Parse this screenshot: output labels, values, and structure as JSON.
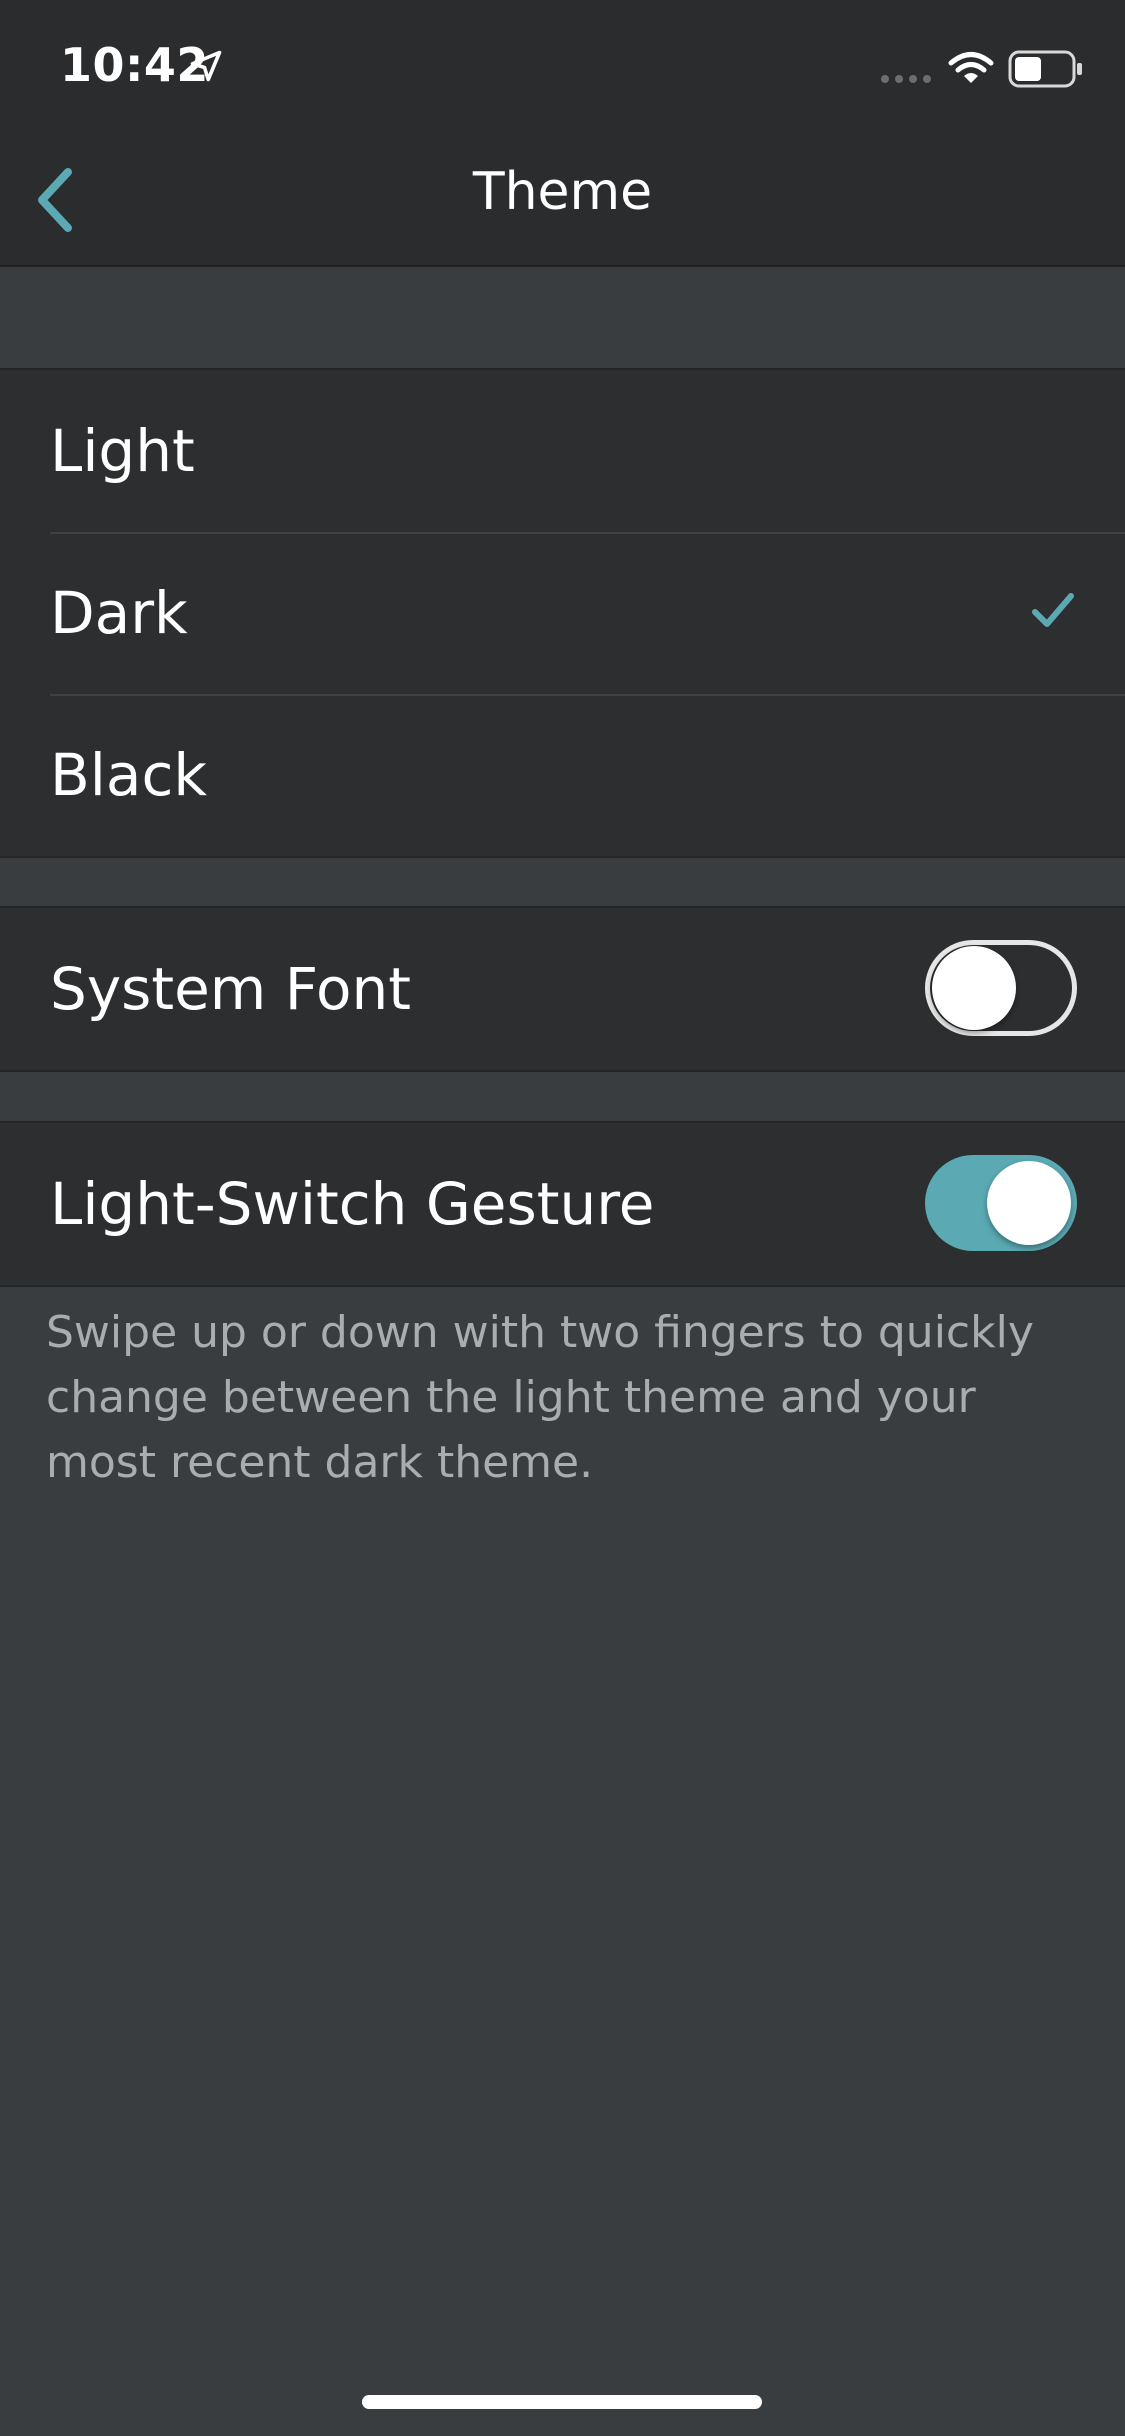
{
  "status_bar": {
    "time": "10:42",
    "icons": [
      "location-arrow-icon",
      "cellular-signal-icon",
      "wifi-icon",
      "battery-icon"
    ]
  },
  "nav": {
    "title": "Theme",
    "back_icon": "chevron-left-icon"
  },
  "themes": {
    "items": [
      {
        "label": "Light",
        "selected": false
      },
      {
        "label": "Dark",
        "selected": true
      },
      {
        "label": "Black",
        "selected": false
      }
    ]
  },
  "system_font": {
    "label": "System Font",
    "enabled": false
  },
  "light_switch": {
    "label": "Light-Switch Gesture",
    "enabled": true,
    "description": "Swipe up or down with two fingers to quickly change between the light theme and your most recent dark theme."
  },
  "colors": {
    "accent": "#5aa9b3",
    "background": "#3a3d3f",
    "cell": "#2c2e30",
    "nav_bar": "#2a2c2d"
  }
}
